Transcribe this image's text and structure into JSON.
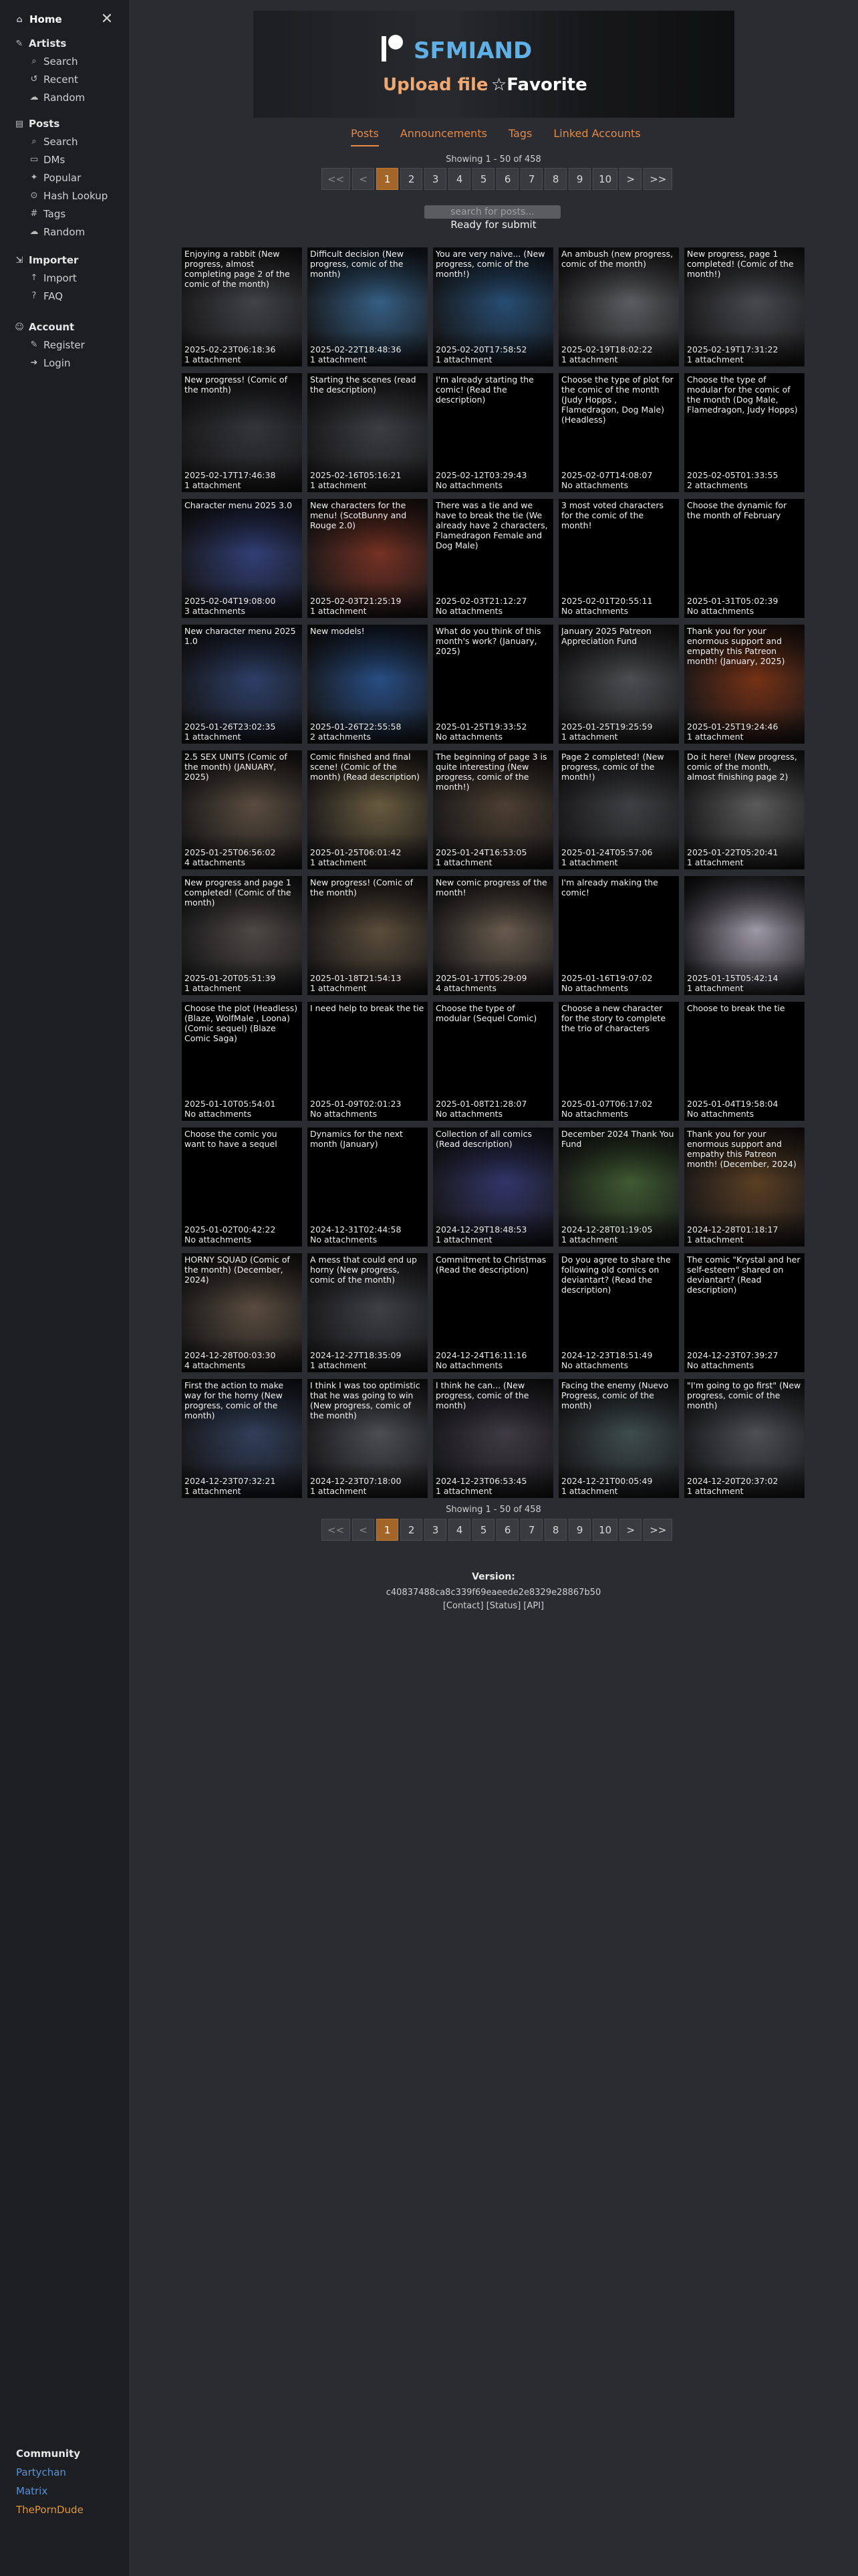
{
  "sidebar": {
    "home": "Home",
    "groups": [
      {
        "title": "Artists",
        "items": [
          "Search",
          "Recent",
          "Random"
        ]
      },
      {
        "title": "Posts",
        "items": [
          "Search",
          "DMs",
          "Popular",
          "Hash Lookup",
          "Tags",
          "Random"
        ]
      },
      {
        "title": "Importer",
        "items": [
          "Import",
          "FAQ"
        ]
      },
      {
        "title": "Account",
        "items": [
          "Register",
          "Login"
        ]
      }
    ],
    "community": {
      "title": "Community",
      "links": [
        {
          "label": "Partychan",
          "color": "#5a93d6"
        },
        {
          "label": "Matrix",
          "color": "#5a93d6"
        },
        {
          "label": "ThePornDude",
          "color": "#e39536"
        }
      ]
    }
  },
  "banner": {
    "name": "SFMIAND",
    "upload": "Upload file",
    "favorite": "☆Favorite"
  },
  "tabs": [
    "Posts",
    "Announcements",
    "Tags",
    "Linked Accounts"
  ],
  "showing": "Showing 1 - 50 of 458",
  "pager": [
    "<<",
    "<",
    "1",
    "2",
    "3",
    "4",
    "5",
    "6",
    "7",
    "8",
    "9",
    "10",
    ">",
    ">>"
  ],
  "search_placeholder": "search for posts...",
  "ready": "Ready for submit",
  "posts": [
    {
      "title": "Enjoying a rabbit (New progress, almost completing page 2 of the comic of the month)",
      "date": "2025-02-23T06:18:36",
      "att": "1 attachment",
      "img": "#4d4e52"
    },
    {
      "title": "Difficult decision (New progress, comic of the month)",
      "date": "2025-02-22T18:48:36",
      "att": "1 attachment",
      "img": "#3f6f9a"
    },
    {
      "title": "You are very naive... (New progress, comic of the month!)",
      "date": "2025-02-20T17:58:52",
      "att": "1 attachment",
      "img": "#2e5a86"
    },
    {
      "title": "An ambush (new progress, comic of the month)",
      "date": "2025-02-19T18:02:22",
      "att": "1 attachment",
      "img": "#6c6d70"
    },
    {
      "title": "New progress, page 1 completed! (Comic of the month!)",
      "date": "2025-02-19T17:31:22",
      "att": "1 attachment",
      "img": "#55565a"
    },
    {
      "title": "New progress! (Comic of the month)",
      "date": "2025-02-17T17:46:38",
      "att": "1 attachment",
      "img": "#3d3e42"
    },
    {
      "title": "Starting the scenes (read the description)",
      "date": "2025-02-16T05:16:21",
      "att": "1 attachment",
      "img": "#47484c"
    },
    {
      "title": "I'm already starting the comic! (Read the description)",
      "date": "2025-02-12T03:29:43",
      "att": "No attachments",
      "img": ""
    },
    {
      "title": "Choose the type of plot for the comic of the month (Judy Hopps , Flamedragon, Dog Male) (Headless)",
      "date": "2025-02-07T14:08:07",
      "att": "No attachments",
      "img": ""
    },
    {
      "title": "Choose the type of modular for the comic of the month (Dog Male, Flamedragon, Judy Hopps)",
      "date": "2025-02-05T01:33:55",
      "att": "2 attachments",
      "img": ""
    },
    {
      "title": "Character menu 2025 3.0",
      "date": "2025-02-04T19:08:00",
      "att": "3 attachments",
      "img": "#3a4a8a"
    },
    {
      "title": "New characters for the menu! (ScotBunny and Rouge 2.0)",
      "date": "2025-02-03T21:25:19",
      "att": "1 attachment",
      "img": "#8a3a2a"
    },
    {
      "title": "There was a tie and we have to break the tie (We already have 2 characters, Flamedragon Female and Dog Male)",
      "date": "2025-02-03T21:12:27",
      "att": "No attachments",
      "img": ""
    },
    {
      "title": "3 most voted characters for the comic of the month!",
      "date": "2025-02-01T20:55:11",
      "att": "No attachments",
      "img": ""
    },
    {
      "title": "Choose the dynamic for the month of February",
      "date": "2025-01-31T05:02:39",
      "att": "No attachments",
      "img": ""
    },
    {
      "title": "New character menu 2025 1.0",
      "date": "2025-01-26T23:02:35",
      "att": "1 attachment",
      "img": "#354a7a"
    },
    {
      "title": "New models!",
      "date": "2025-01-26T22:55:58",
      "att": "2 attachments",
      "img": "#2f5a9a"
    },
    {
      "title": "What do you think of this month's work? (January, 2025)",
      "date": "2025-01-25T19:33:52",
      "att": "No attachments",
      "img": ""
    },
    {
      "title": "January 2025 Patreon Appreciation Fund",
      "date": "2025-01-25T19:25:59",
      "att": "1 attachment",
      "img": "#5a5b5e"
    },
    {
      "title": "Thank you for your enormous support and empathy this Patreon month! (January, 2025)",
      "date": "2025-01-25T19:24:46",
      "att": "1 attachment",
      "img": "#8a3a1a"
    },
    {
      "title": "2.5 SEX UNITS (Comic of the month) (JANUARY, 2025)",
      "date": "2025-01-25T06:56:02",
      "att": "4 attachments",
      "img": "#6a5a4a"
    },
    {
      "title": "Comic finished and final scene! (Comic of the month) (Read description)",
      "date": "2025-01-25T06:01:42",
      "att": "1 attachment",
      "img": "#7a6a4a"
    },
    {
      "title": "The beginning of page 3 is quite interesting (New progress, comic of the month!)",
      "date": "2025-01-24T16:53:05",
      "att": "1 attachment",
      "img": "#5a4a3a"
    },
    {
      "title": "Page 2 completed! (New progress, comic of the month!)",
      "date": "2025-01-24T05:57:06",
      "att": "1 attachment",
      "img": "#4a4b4e"
    },
    {
      "title": "Do it here! (New progress, comic of the month, almost finishing page 2)",
      "date": "2025-01-22T05:20:41",
      "att": "1 attachment",
      "img": "#6a6a6a"
    },
    {
      "title": "New progress and page 1 completed! (Comic of the month)",
      "date": "2025-01-20T05:51:39",
      "att": "1 attachment",
      "img": "#5a5550"
    },
    {
      "title": "New progress! (Comic of the month)",
      "date": "2025-01-18T21:54:13",
      "att": "1 attachment",
      "img": "#6a5a45"
    },
    {
      "title": "New comic progress of the month!",
      "date": "2025-01-17T05:29:09",
      "att": "4 attachments",
      "img": "#7a6a5a"
    },
    {
      "title": "I'm already making the comic!",
      "date": "2025-01-16T19:07:02",
      "att": "No attachments",
      "img": ""
    },
    {
      "title": "",
      "date": "2025-01-15T05:42:14",
      "att": "1 attachment",
      "img": "#b9b3c4"
    },
    {
      "title": "Choose the plot (Headless) (Blaze, WolfMale , Loona) (Comic sequel) (Blaze Comic Saga)",
      "date": "2025-01-10T05:54:01",
      "att": "No attachments",
      "img": ""
    },
    {
      "title": "I need help to break the tie",
      "date": "2025-01-09T02:01:23",
      "att": "No attachments",
      "img": ""
    },
    {
      "title": "Choose the type of modular (Sequel Comic)",
      "date": "2025-01-08T21:28:07",
      "att": "No attachments",
      "img": ""
    },
    {
      "title": "Choose a new character for the story to complete the trio of characters",
      "date": "2025-01-07T06:17:02",
      "att": "No attachments",
      "img": ""
    },
    {
      "title": "Choose to break the tie",
      "date": "2025-01-04T19:58:04",
      "att": "No attachments",
      "img": ""
    },
    {
      "title": "Choose the comic you want to have a sequel",
      "date": "2025-01-02T00:42:22",
      "att": "No attachments",
      "img": ""
    },
    {
      "title": "Dynamics for the next month (January)",
      "date": "2024-12-31T02:44:58",
      "att": "No attachments",
      "img": ""
    },
    {
      "title": "Collection of all comics (Read description)",
      "date": "2024-12-29T18:48:53",
      "att": "1 attachment",
      "img": "#3a3f7a"
    },
    {
      "title": "December 2024 Thank You Fund",
      "date": "2024-12-28T01:19:05",
      "att": "1 attachment",
      "img": "#4a6a3a"
    },
    {
      "title": "Thank you for your enormous support and empathy this Patreon month! (December, 2024)",
      "date": "2024-12-28T01:18:17",
      "att": "1 attachment",
      "img": "#6a4a2a"
    },
    {
      "title": "HORNY SQUAD (Comic of the month) (December, 2024)",
      "date": "2024-12-28T00:03:30",
      "att": "4 attachments",
      "img": "#6a5a4a"
    },
    {
      "title": "A mess that could end up horny (New progress, comic of the month)",
      "date": "2024-12-27T18:35:09",
      "att": "1 attachment",
      "img": "#4a4b50"
    },
    {
      "title": "Commitment to Christmas (Read the description)",
      "date": "2024-12-24T16:11:16",
      "att": "No attachments",
      "img": ""
    },
    {
      "title": "Do you agree to share the following old comics on deviantart? (Read the description)",
      "date": "2024-12-23T18:51:49",
      "att": "No attachments",
      "img": ""
    },
    {
      "title": "The comic \"Krystal and her self-esteem\" shared on deviantart? (Read description)",
      "date": "2024-12-23T07:39:27",
      "att": "No attachments",
      "img": ""
    },
    {
      "title": "First the action to make way for the horny (New progress, comic of the month)",
      "date": "2024-12-23T07:32:21",
      "att": "1 attachment",
      "img": "#3a4a6a"
    },
    {
      "title": "I think I was too optimistic that he was going to win (New progress, comic of the month)",
      "date": "2024-12-23T07:18:00",
      "att": "1 attachment",
      "img": "#5a5b60"
    },
    {
      "title": "I think he can... (New progress, comic of the month)",
      "date": "2024-12-23T06:53:45",
      "att": "1 attachment",
      "img": "#4a4550"
    },
    {
      "title": "Facing the enemy (Nuevo Progress, comic of the month)",
      "date": "2024-12-21T00:05:49",
      "att": "1 attachment",
      "img": "#4a5a5a"
    },
    {
      "title": "\"I'm going to go first\" (New progress, comic of the month)",
      "date": "2024-12-20T20:37:02",
      "att": "1 attachment",
      "img": "#5a5d62"
    }
  ],
  "version": {
    "title": "Version:",
    "hash": "c40837488ca8c339f69eaeede2e8329e28867b50",
    "links": "[Contact] [Status] [API]"
  }
}
